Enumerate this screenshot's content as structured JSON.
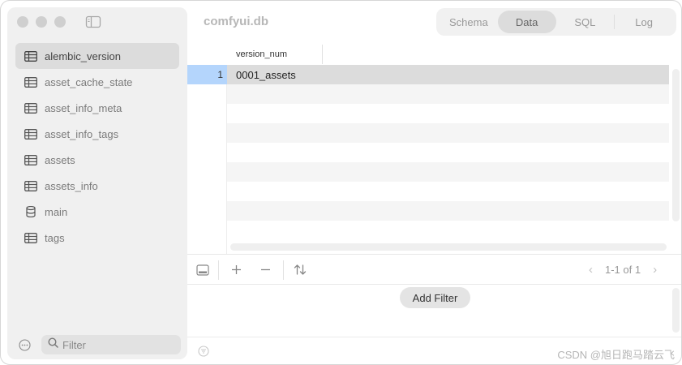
{
  "window": {
    "title": "comfyui.db"
  },
  "tabs": [
    {
      "label": "Schema",
      "active": false
    },
    {
      "label": "Data",
      "active": true
    },
    {
      "label": "SQL",
      "active": false
    },
    {
      "label": "Log",
      "active": false
    }
  ],
  "sidebar": {
    "items": [
      {
        "label": "alembic_version",
        "icon": "table-icon",
        "active": true
      },
      {
        "label": "asset_cache_state",
        "icon": "table-icon",
        "active": false
      },
      {
        "label": "asset_info_meta",
        "icon": "table-icon",
        "active": false
      },
      {
        "label": "asset_info_tags",
        "icon": "table-icon",
        "active": false
      },
      {
        "label": "assets",
        "icon": "table-icon",
        "active": false
      },
      {
        "label": "assets_info",
        "icon": "table-icon",
        "active": false
      },
      {
        "label": "main",
        "icon": "database-icon",
        "active": false
      },
      {
        "label": "tags",
        "icon": "table-icon",
        "active": false
      }
    ],
    "filter_placeholder": "Filter"
  },
  "grid": {
    "columns": [
      "version_num"
    ],
    "rows": [
      {
        "num": "1",
        "values": [
          "0001_assets"
        ]
      }
    ]
  },
  "toolbar": {
    "pagination": "1-1 of 1"
  },
  "filter": {
    "add_label": "Add Filter"
  },
  "footer": {
    "watermark": "CSDN @旭日跑马踏云飞"
  },
  "colors": {
    "selected_row_number": "#b4d5fc",
    "selected_row": "#dcdcdc"
  }
}
